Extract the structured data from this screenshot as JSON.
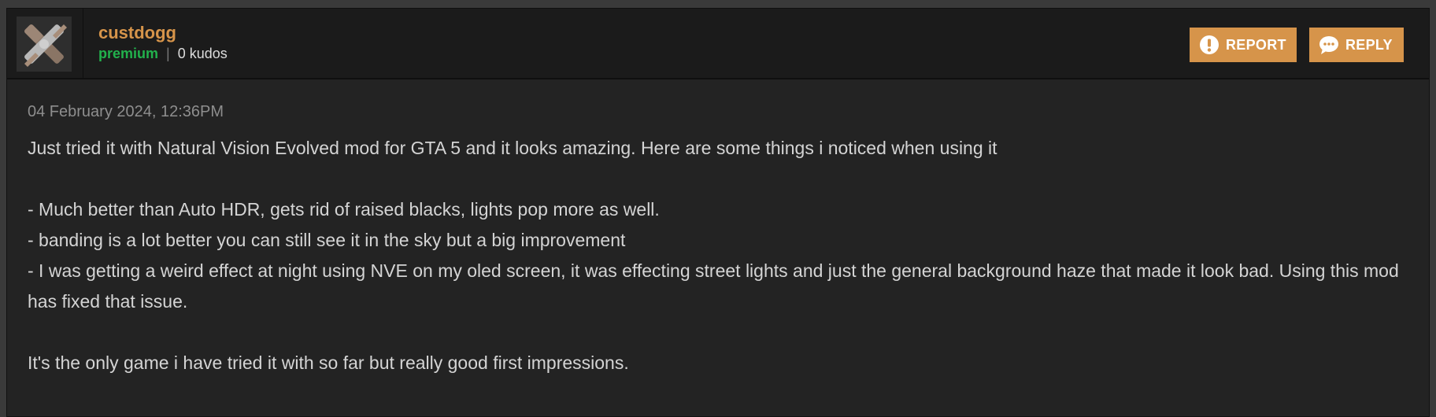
{
  "user": {
    "name": "custdogg",
    "rank": "premium",
    "separator": "|",
    "kudos": "0 kudos",
    "avatar_icon": "x-logo-icon"
  },
  "actions": {
    "report_label": "REPORT",
    "reply_label": "REPLY",
    "report_icon": "exclamation-circle-icon",
    "reply_icon": "speech-bubble-icon"
  },
  "post": {
    "timestamp": "04 February 2024, 12:36PM",
    "paragraphs": [
      "Just tried it with Natural Vision Evolved mod for GTA 5 and it looks amazing. Here are some things i noticed when using it",
      "- Much better than Auto HDR, gets rid of raised blacks, lights pop more as well.",
      "- banding is a lot better you can still see it in the sky but a big improvement",
      "- I was getting a weird effect at night using NVE on my oled screen, it was effecting street lights and just the general background haze that made it look bad. Using this mod has fixed that issue.",
      "It's the only game i have tried it with so far but really good first impressions."
    ]
  },
  "colors": {
    "accent": "#d6944a",
    "rank_green": "#22b14c",
    "background": "#232323",
    "header_background": "#1b1b1b",
    "body_text": "#d4d4d4",
    "timestamp_text": "#8e8e8e"
  }
}
